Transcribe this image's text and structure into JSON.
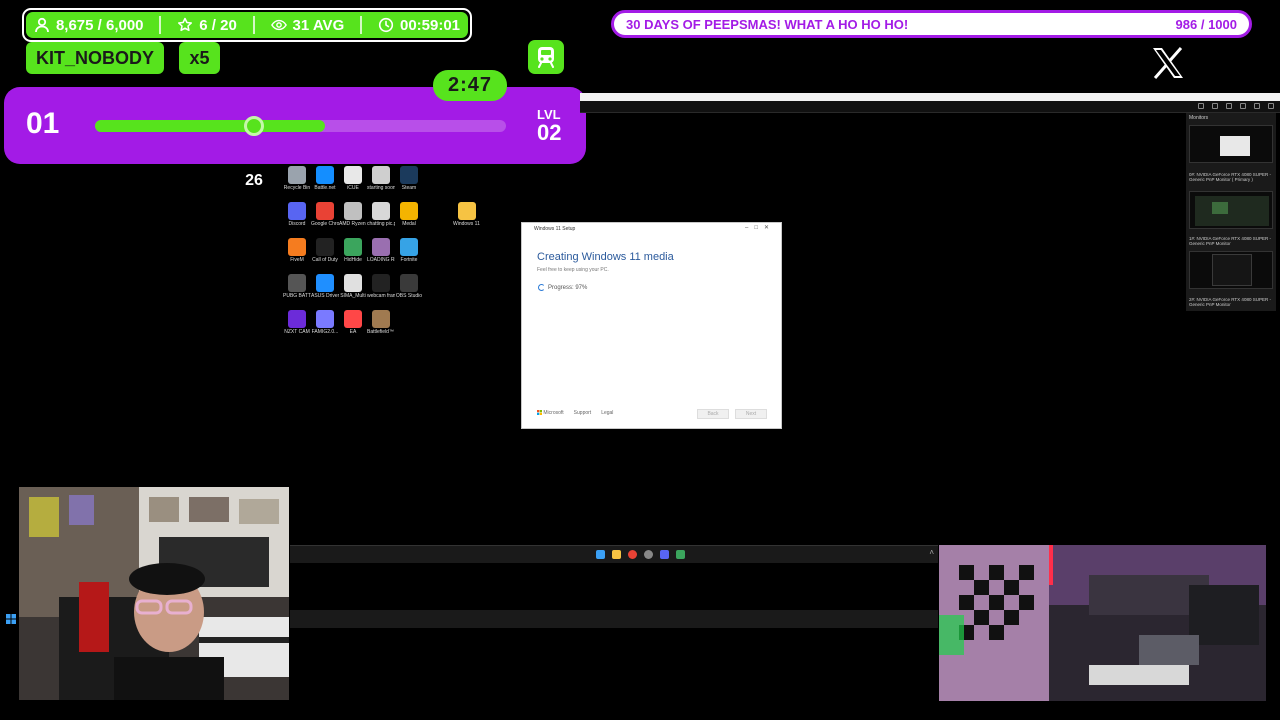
{
  "overlay": {
    "stats": {
      "followers": "8,675 / 6,000",
      "stars": "6 / 20",
      "viewers": "31 AVG",
      "timer": "00:59:01"
    },
    "username": "KIT_NOBODY",
    "multiplier": "x5",
    "level": {
      "current": "01",
      "next_label": "LVL",
      "next": "02",
      "progress_value": "26",
      "progress_fraction": 0.56,
      "countdown": "2:47"
    },
    "goal": {
      "title": "30 DAYS OF PEEPSMAS! WHAT A HO HO HO!",
      "count": "986 / 1000"
    },
    "colors": {
      "accent_green": "#57e31d",
      "accent_purple": "#a31be6"
    }
  },
  "desktop": {
    "icons": [
      {
        "label": "Recycle Bin",
        "icon": "recycle-bin-icon",
        "color": "#9aa3ad"
      },
      {
        "label": "Battle.net",
        "icon": "battlenet-icon",
        "color": "#148eff"
      },
      {
        "label": "iCUE",
        "icon": "icue-icon",
        "color": "#e8e8e8"
      },
      {
        "label": "starting soon.mp4",
        "icon": "video-file-icon",
        "color": "#cfcfcf"
      },
      {
        "label": "Steam",
        "icon": "steam-icon",
        "color": "#1b3a5c"
      },
      {
        "label": "Discord",
        "icon": "discord-icon",
        "color": "#5865f2"
      },
      {
        "label": "Google Chrome",
        "icon": "chrome-icon",
        "color": "#e94235"
      },
      {
        "label": "AMD Ryzen Master",
        "icon": "amd-icon",
        "color": "#c0c0c0"
      },
      {
        "label": "chatting pic.png",
        "icon": "image-file-icon",
        "color": "#d8d8d8"
      },
      {
        "label": "Medal",
        "icon": "medal-icon",
        "color": "#f4b400"
      },
      {
        "label": "Windows 11 license Key...",
        "icon": "folder-icon",
        "color": "#f6c343"
      },
      {
        "label": "FiveM",
        "icon": "fivem-icon",
        "color": "#f57c1f"
      },
      {
        "label": "Call of Duty",
        "icon": "cod-icon",
        "color": "#222222"
      },
      {
        "label": "HidHide",
        "icon": "hidhide-icon",
        "color": "#3ba55d"
      },
      {
        "label": "LOADING RF.mp4",
        "icon": "video-file-icon",
        "color": "#9a6fb0"
      },
      {
        "label": "Fortnite",
        "icon": "fortnite-icon",
        "color": "#36a3e6"
      },
      {
        "label": "PUBG BATTLEGR...",
        "icon": "pubg-icon",
        "color": "#555555"
      },
      {
        "label": "ASUS DriverHub",
        "icon": "asus-icon",
        "color": "#1f8fff"
      },
      {
        "label": "SIMA_Multi",
        "icon": "sima-icon",
        "color": "#e0e0e0"
      },
      {
        "label": "webcam frame.png",
        "icon": "image-file-icon",
        "color": "#222222"
      },
      {
        "label": "OBS Studio",
        "icon": "obs-icon",
        "color": "#3a3a3a"
      },
      {
        "label": "NZXT CAM",
        "icon": "nzxt-icon",
        "color": "#6c2bd9"
      },
      {
        "label": "FAMIG2.0...",
        "icon": "app-icon",
        "color": "#7a7aff"
      },
      {
        "label": "EA",
        "icon": "ea-icon",
        "color": "#ff4747"
      },
      {
        "label": "Battlefield™ 6",
        "icon": "battlefield-icon",
        "color": "#a07a50"
      }
    ],
    "setup": {
      "title": "Windows 11 Setup",
      "heading": "Creating Windows 11 media",
      "subheading": "Feel free to keep using your PC.",
      "progress": "Progress: 97%",
      "footer_brand": "Microsoft",
      "footer_support": "Support",
      "footer_legal": "Legal",
      "back_button": "Back",
      "next_button": "Next"
    },
    "monitors": {
      "title": "Monitors",
      "items": [
        {
          "label": "0#: NVIDIA GeForce RTX 4080 SUPER - Generic PnP Monitor ( Primary )"
        },
        {
          "label": "1#: NVIDIA GeForce RTX 4080 SUPER - Generic PnP Monitor"
        },
        {
          "label": "2#: NVIDIA GeForce RTX 4080 SUPER - Generic PnP Monitor"
        }
      ]
    }
  }
}
